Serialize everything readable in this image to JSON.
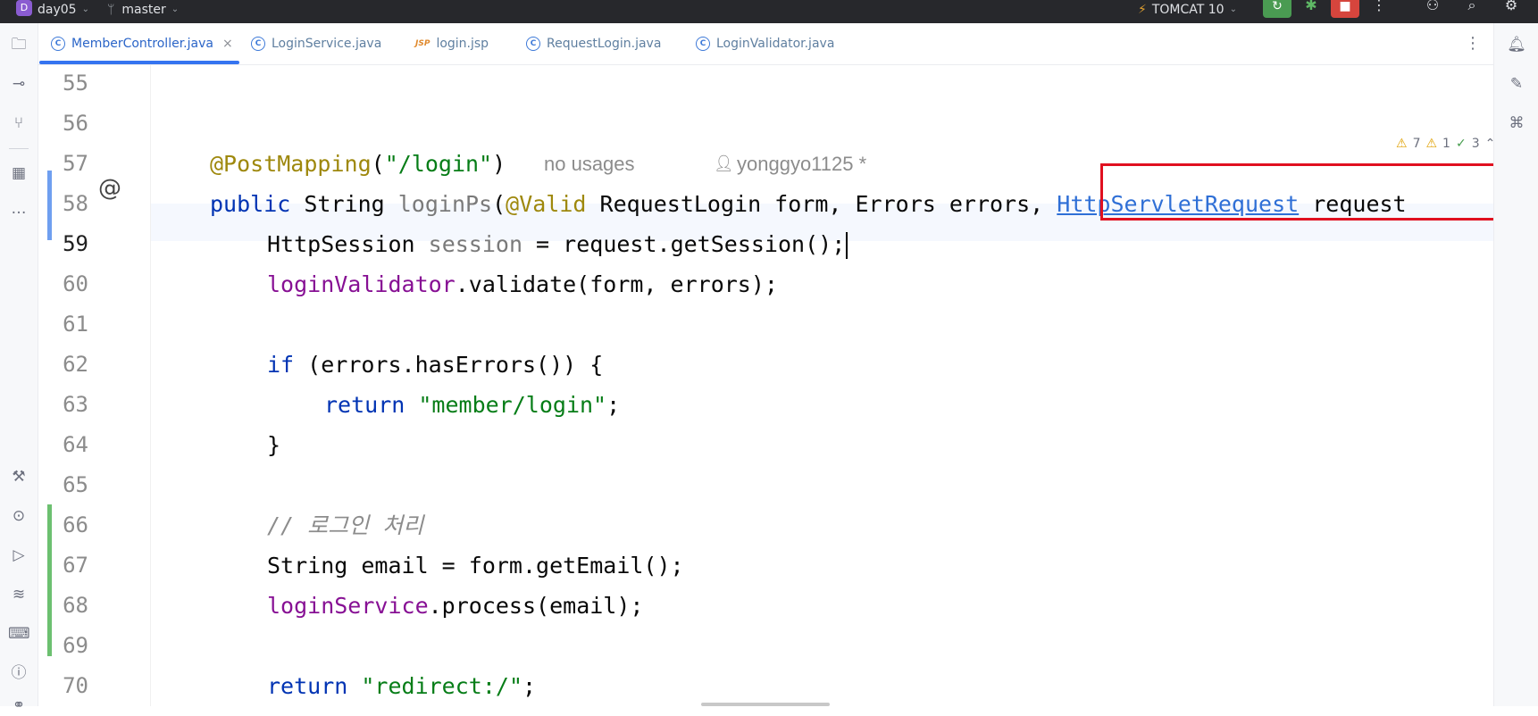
{
  "titlebar": {
    "project_badge": "D",
    "project": "day05",
    "branch": "master",
    "run_config": "TOMCAT 10",
    "icons": [
      "run-icon",
      "debug-icon",
      "stop-icon",
      "more-icon",
      "add-user-icon",
      "search-icon",
      "settings-icon"
    ]
  },
  "tabs": [
    {
      "label": "MemberController.java",
      "icon": "java-class-icon",
      "active": true,
      "close": "×"
    },
    {
      "label": "LoginService.java",
      "icon": "java-class-icon"
    },
    {
      "label": "login.jsp",
      "icon": "jsp-icon",
      "icon_text": "JSP"
    },
    {
      "label": "RequestLogin.java",
      "icon": "java-class-icon"
    },
    {
      "label": "LoginValidator.java",
      "icon": "java-class-icon"
    }
  ],
  "inspections": {
    "warnings": "7",
    "weak_warnings": "1",
    "ok": "3"
  },
  "editor": {
    "lines": [
      {
        "num": "55"
      },
      {
        "num": "56"
      },
      {
        "num": "57",
        "annotation": "@PostMapping",
        "paren_open": "(",
        "path": "\"/login\"",
        "paren_close": ")",
        "usages": "no usages",
        "author": "yonggyo1125 *"
      },
      {
        "num": "58",
        "marker": "@",
        "kw_public": "public",
        "type_string": " String ",
        "method": "loginPs",
        "open": "(",
        "valid": "@Valid",
        "params": " RequestLogin form, Errors errors, ",
        "highlight_type": "HttpServletRequest",
        "last_param": " request"
      },
      {
        "num": "59",
        "type": "HttpSession",
        "var": "session",
        "rest_a": " = r",
        "rest_b": "equest.getSession();"
      },
      {
        "num": "60",
        "field": "loginValidator",
        "rest": ".validate(form, errors);"
      },
      {
        "num": "61"
      },
      {
        "num": "62",
        "kw": "if",
        "rest": " (errors.hasErrors()) {"
      },
      {
        "num": "63",
        "kw": "return",
        "str": "\"member/login\"",
        "end": ";"
      },
      {
        "num": "64",
        "text": "}"
      },
      {
        "num": "65"
      },
      {
        "num": "66",
        "comment": "// 로그인 처리"
      },
      {
        "num": "67",
        "text": "String email = form.getEmail();"
      },
      {
        "num": "68",
        "field": "loginService",
        "rest": ".process(email);"
      },
      {
        "num": "69"
      },
      {
        "num": "70",
        "kw": "return",
        "str": "\"redirect:/\"",
        "end": ";"
      }
    ]
  },
  "colors": {
    "highlight_box": "#e01020",
    "accent": "#3574f0",
    "keyword": "#0033b3",
    "string": "#067d17",
    "field": "#871094",
    "annotation": "#9e880d"
  }
}
